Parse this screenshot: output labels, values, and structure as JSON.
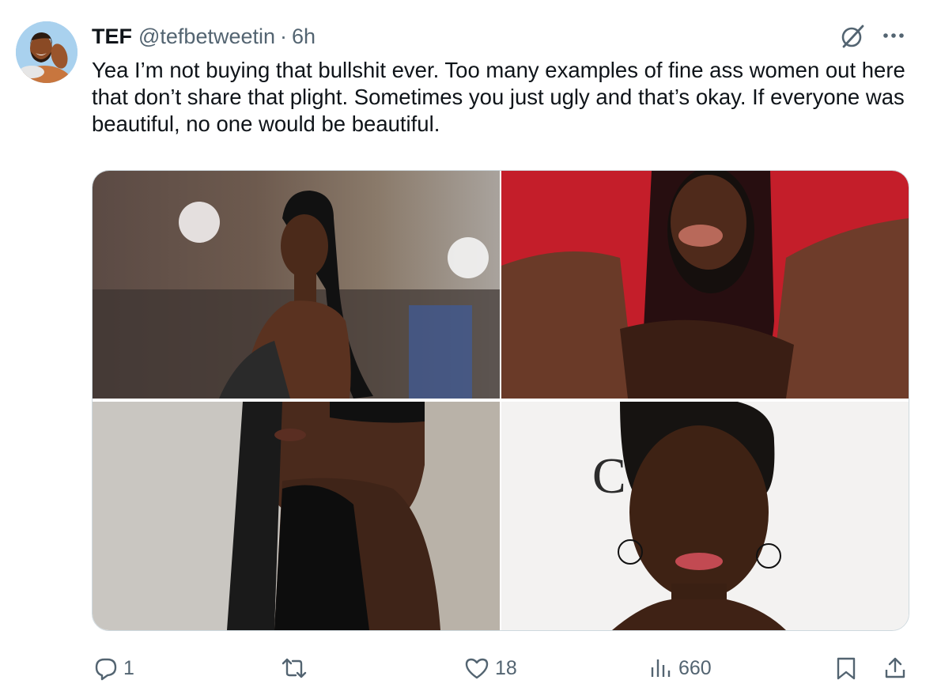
{
  "tweet": {
    "display_name": "TEF",
    "handle": "@tefbetweetin",
    "separator": "·",
    "time": "6h",
    "text": "Yea I’m not buying that bullshit ever. Too many examples of fine ass women out here that don’t share that plight. Sometimes you just ugly and that’s okay. If everyone was beautiful, no one would be beautiful."
  },
  "media": {
    "photos": [
      {
        "name": "photo-woman-ponytail-event"
      },
      {
        "name": "photo-woman-red-background"
      },
      {
        "name": "photo-woman-braids-black-dress"
      },
      {
        "name": "photo-woman-short-hair-hoop-earrings",
        "backdrop_text": "C  É NA"
      }
    ]
  },
  "actions": {
    "reply": {
      "icon": "reply-icon",
      "count": "1"
    },
    "retweet": {
      "icon": "retweet-icon",
      "count": ""
    },
    "like": {
      "icon": "heart-icon",
      "count": "18"
    },
    "views": {
      "icon": "views-icon",
      "count": "660"
    },
    "bookmark": {
      "icon": "bookmark-icon"
    },
    "share": {
      "icon": "share-icon"
    }
  },
  "colors": {
    "text_primary": "#0f1419",
    "text_secondary": "#536471",
    "border": "#cfd9de"
  }
}
